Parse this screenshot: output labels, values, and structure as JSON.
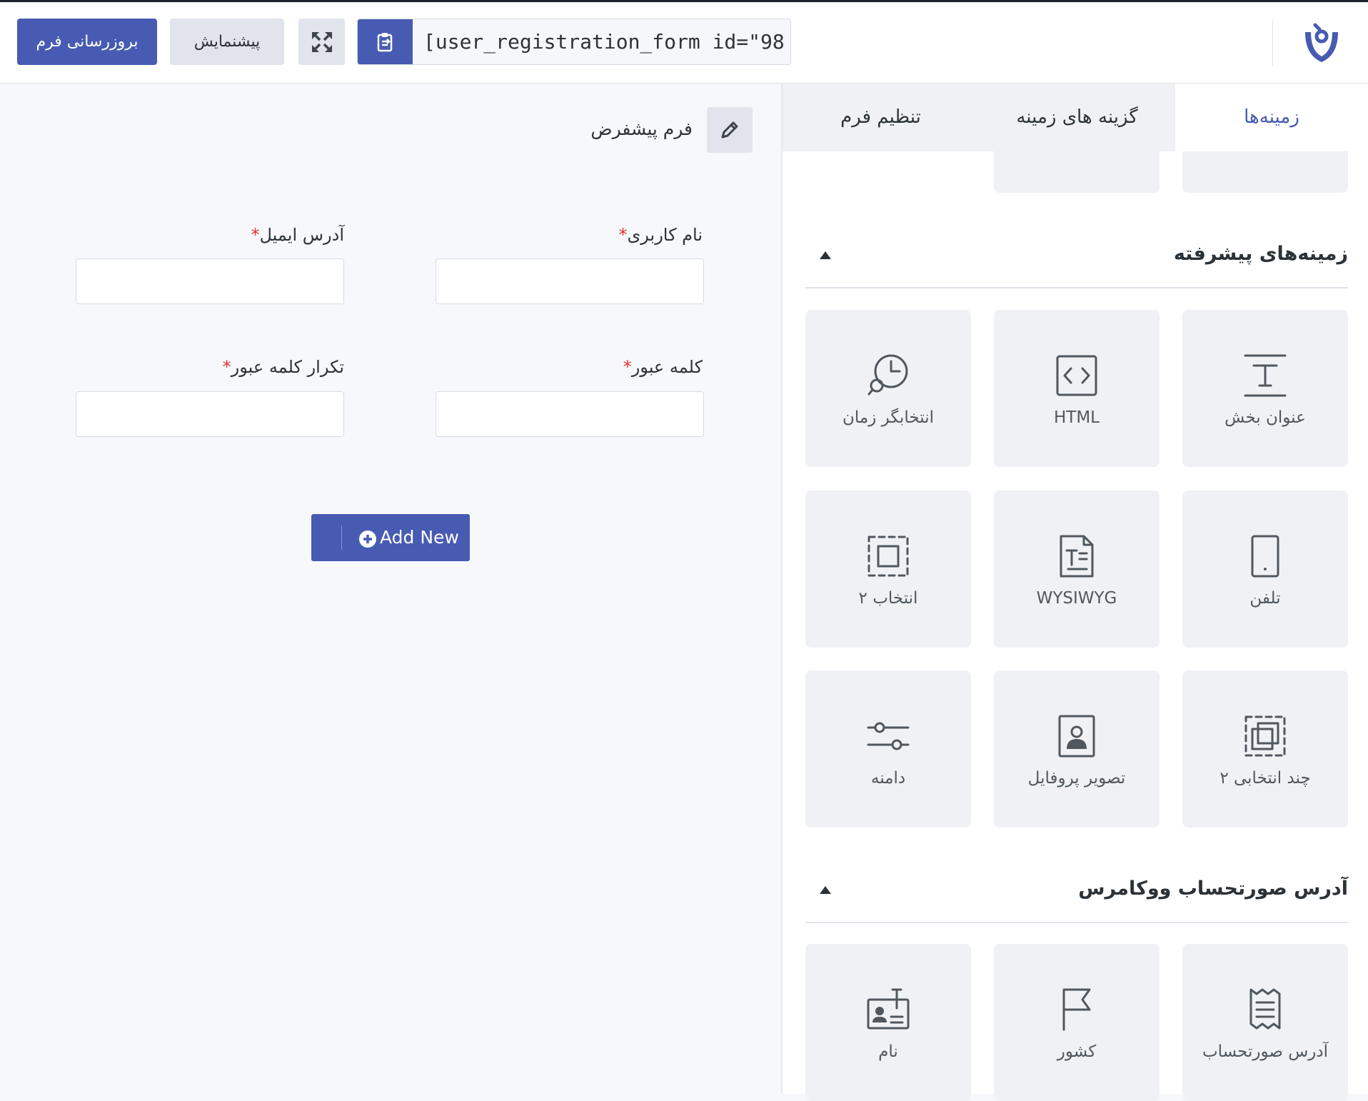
{
  "header": {
    "update_label": "بروزرسانی فرم",
    "preview_label": "پیشنمایش",
    "shortcode": "[user_registration_form id=\"98"
  },
  "form": {
    "title": "فرم پیشفرض",
    "fields": [
      {
        "label": "نام کاربری",
        "required_mark": "*"
      },
      {
        "label": "آدرس ایمیل",
        "required_mark": "*"
      },
      {
        "label": "کلمه عبور",
        "required_mark": "*"
      },
      {
        "label": "تکرار کلمه عبور",
        "required_mark": "*"
      }
    ],
    "add_new_label": "Add New"
  },
  "sidebar": {
    "tabs": [
      {
        "label": "زمینه‌ها",
        "active": true
      },
      {
        "label": "گزینه های زمینه",
        "active": false
      },
      {
        "label": "تنظیم فرم",
        "active": false
      }
    ],
    "sections": [
      {
        "title": "زمینه‌های پیشرفته",
        "tiles": [
          {
            "label": "عنوان بخش",
            "icon": "section-title-icon"
          },
          {
            "label": "HTML",
            "icon": "html-code-icon"
          },
          {
            "label": "انتخابگر زمان",
            "icon": "time-picker-icon"
          },
          {
            "label": "تلفن",
            "icon": "phone-icon"
          },
          {
            "label": "WYSIWYG",
            "icon": "wysiwyg-icon"
          },
          {
            "label": "انتخاب ۲",
            "icon": "select2-icon"
          },
          {
            "label": "چند انتخابی ۲",
            "icon": "multi-select-icon"
          },
          {
            "label": "تصویر پروفایل",
            "icon": "profile-picture-icon"
          },
          {
            "label": "دامنه",
            "icon": "range-slider-icon"
          }
        ]
      },
      {
        "title": "آدرس صورتحساب ووکامرس",
        "tiles": [
          {
            "label": "آدرس صورتحساب",
            "icon": "billing-address-icon"
          },
          {
            "label": "کشور",
            "icon": "flag-icon"
          },
          {
            "label": "نام",
            "icon": "name-card-icon"
          }
        ]
      }
    ]
  },
  "colors": {
    "accent": "#475bb2",
    "required": "#e03131",
    "tile_bg": "#eff1f5"
  }
}
